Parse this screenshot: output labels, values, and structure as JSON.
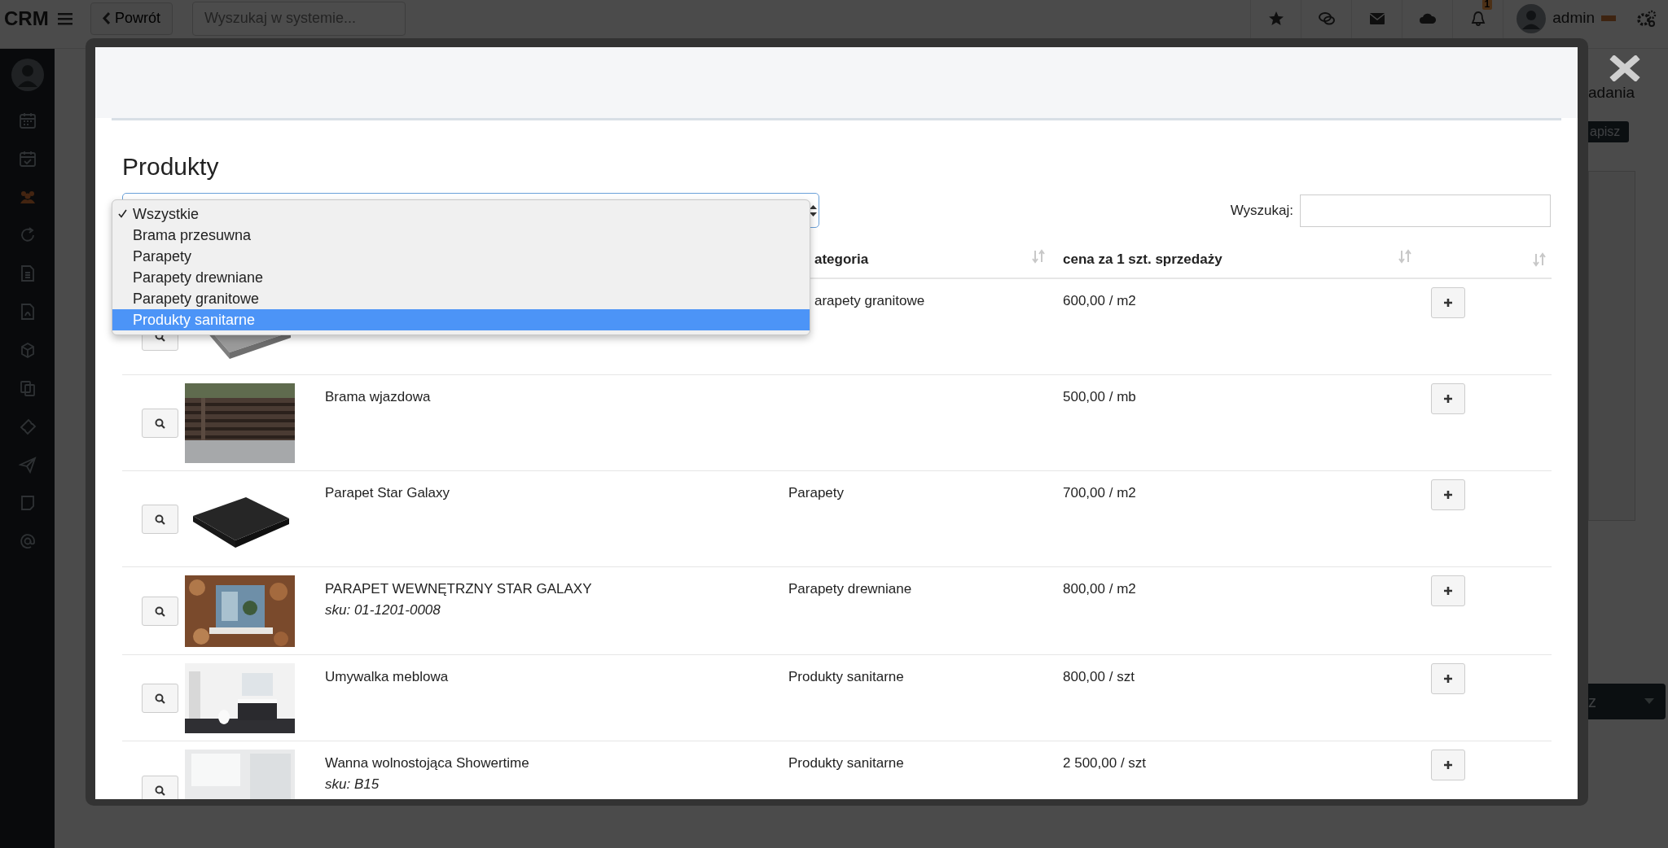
{
  "topbar": {
    "logo": "CRM",
    "back_button": "Powrót",
    "search": {
      "placeholder": "Wyszukaj w systemie..."
    },
    "notification_badge": "1",
    "user": "admin"
  },
  "background_page": {
    "heading": "adania",
    "save_button": "apisz",
    "bottom_button": "z"
  },
  "modal": {
    "title": "Produkty",
    "search_label": "Wyszukaj:",
    "category_dropdown": [
      {
        "label": "Wszystkie",
        "checked": true,
        "selected": false
      },
      {
        "label": "Brama przesuwna",
        "checked": false,
        "selected": false
      },
      {
        "label": "Parapety",
        "checked": false,
        "selected": false
      },
      {
        "label": "Parapety drewniane",
        "checked": false,
        "selected": false
      },
      {
        "label": "Parapety granitowe",
        "checked": false,
        "selected": false
      },
      {
        "label": "Produkty sanitarne",
        "checked": false,
        "selected": true
      }
    ],
    "columns": {
      "category": "ategoria",
      "price": "cena za 1 szt. sprzedaży"
    },
    "rows": [
      {
        "category": "arapety granitowe",
        "price": "600,00 / m2"
      },
      {
        "name": "Brama wjazdowa",
        "price": "500,00 / mb"
      },
      {
        "name": "Parapet Star Galaxy",
        "category": "Parapety",
        "price": "700,00 / m2"
      },
      {
        "name": "PARAPET WEWNĘTRZNY STAR GALAXY",
        "sku": "sku: 01-1201-0008",
        "category": "Parapety drewniane",
        "price": "800,00 / m2"
      },
      {
        "name": "Umywalka meblowa",
        "category": "Produkty sanitarne",
        "price": "800,00 / szt"
      },
      {
        "name": "Wanna wolnostojąca Showertime",
        "sku": "sku: B15",
        "category": "Produkty sanitarne",
        "price": "2 500,00 / szt"
      }
    ]
  }
}
